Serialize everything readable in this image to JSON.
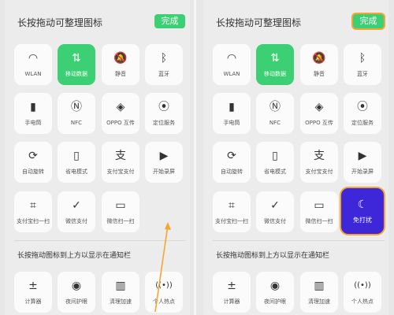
{
  "left": {
    "header": {
      "title": "长按拖动可整理图标",
      "done_label": "完成"
    },
    "tiles": [
      {
        "label": "WLAN",
        "icon": "wifi-icon",
        "glyph": "◠"
      },
      {
        "label": "移动数据",
        "icon": "mobile-data-icon",
        "glyph": "⇅"
      },
      {
        "label": "静音",
        "icon": "mute-bell-icon",
        "glyph": "🔕"
      },
      {
        "label": "蓝牙",
        "icon": "bluetooth-icon",
        "glyph": "ᛒ"
      },
      {
        "label": "手电筒",
        "icon": "flashlight-icon",
        "glyph": "▮"
      },
      {
        "label": "NFC",
        "icon": "nfc-icon",
        "glyph": "Ⓝ"
      },
      {
        "label": "OPPO 互传",
        "icon": "oppo-share-icon",
        "glyph": "◈"
      },
      {
        "label": "定位服务",
        "icon": "location-icon",
        "glyph": "⦿"
      },
      {
        "label": "自动旋转",
        "icon": "auto-rotate-icon",
        "glyph": "⟳"
      },
      {
        "label": "省电模式",
        "icon": "battery-saver-icon",
        "glyph": "▯"
      },
      {
        "label": "支付宝支付",
        "icon": "alipay-icon",
        "glyph": "支"
      },
      {
        "label": "开始录屏",
        "icon": "screen-record-icon",
        "glyph": "▶"
      },
      {
        "label": "支付宝扫一扫",
        "icon": "scan-icon",
        "glyph": "⌗"
      },
      {
        "label": "微信支付",
        "icon": "wechat-pay-icon",
        "glyph": "✓"
      },
      {
        "label": "微信扫一扫",
        "icon": "wechat-scan-icon",
        "glyph": "▭"
      }
    ],
    "section_title": "长按拖动图标到上方以显示在通知栏",
    "bottom_tiles": [
      {
        "label": "计算器",
        "icon": "calculator-icon",
        "glyph": "±"
      },
      {
        "label": "夜间护眼",
        "icon": "eye-icon",
        "glyph": "◉"
      },
      {
        "label": "清理加速",
        "icon": "trash-icon",
        "glyph": "▥"
      },
      {
        "label": "个人热点",
        "icon": "hotspot-icon",
        "glyph": "((•))"
      }
    ]
  },
  "right": {
    "header": {
      "title": "长按拖动可整理图标",
      "done_label": "完成"
    },
    "tiles": [
      {
        "label": "WLAN",
        "icon": "wifi-icon",
        "glyph": "◠"
      },
      {
        "label": "移动数据",
        "icon": "mobile-data-icon",
        "glyph": "⇅"
      },
      {
        "label": "静音",
        "icon": "mute-bell-icon",
        "glyph": "🔕"
      },
      {
        "label": "蓝牙",
        "icon": "bluetooth-icon",
        "glyph": "ᛒ"
      },
      {
        "label": "手电筒",
        "icon": "flashlight-icon",
        "glyph": "▮"
      },
      {
        "label": "NFC",
        "icon": "nfc-icon",
        "glyph": "Ⓝ"
      },
      {
        "label": "OPPO 互传",
        "icon": "oppo-share-icon",
        "glyph": "◈"
      },
      {
        "label": "定位服务",
        "icon": "location-icon",
        "glyph": "⦿"
      },
      {
        "label": "自动旋转",
        "icon": "auto-rotate-icon",
        "glyph": "⟳"
      },
      {
        "label": "省电模式",
        "icon": "battery-saver-icon",
        "glyph": "▯"
      },
      {
        "label": "支付宝支付",
        "icon": "alipay-icon",
        "glyph": "支"
      },
      {
        "label": "开始录屏",
        "icon": "screen-record-icon",
        "glyph": "▶"
      },
      {
        "label": "支付宝扫一扫",
        "icon": "scan-icon",
        "glyph": "⌗"
      },
      {
        "label": "微信支付",
        "icon": "wechat-pay-icon",
        "glyph": "✓"
      },
      {
        "label": "微信扫一扫",
        "icon": "wechat-scan-icon",
        "glyph": "▭"
      },
      {
        "label": "免打扰",
        "icon": "moon-icon",
        "glyph": "☾"
      }
    ],
    "section_title": "长按拖动图标到上方以显示在通知栏",
    "bottom_tiles": [
      {
        "label": "计算器",
        "icon": "calculator-icon",
        "glyph": "±"
      },
      {
        "label": "夜间护眼",
        "icon": "eye-icon",
        "glyph": "◉"
      },
      {
        "label": "清理加速",
        "icon": "trash-icon",
        "glyph": "▥"
      },
      {
        "label": "个人热点",
        "icon": "hotspot-icon",
        "glyph": "((•))"
      }
    ]
  },
  "colors": {
    "accent": "#3dcf74",
    "dnd": "#3e26d9",
    "highlight": "#f6a532"
  }
}
